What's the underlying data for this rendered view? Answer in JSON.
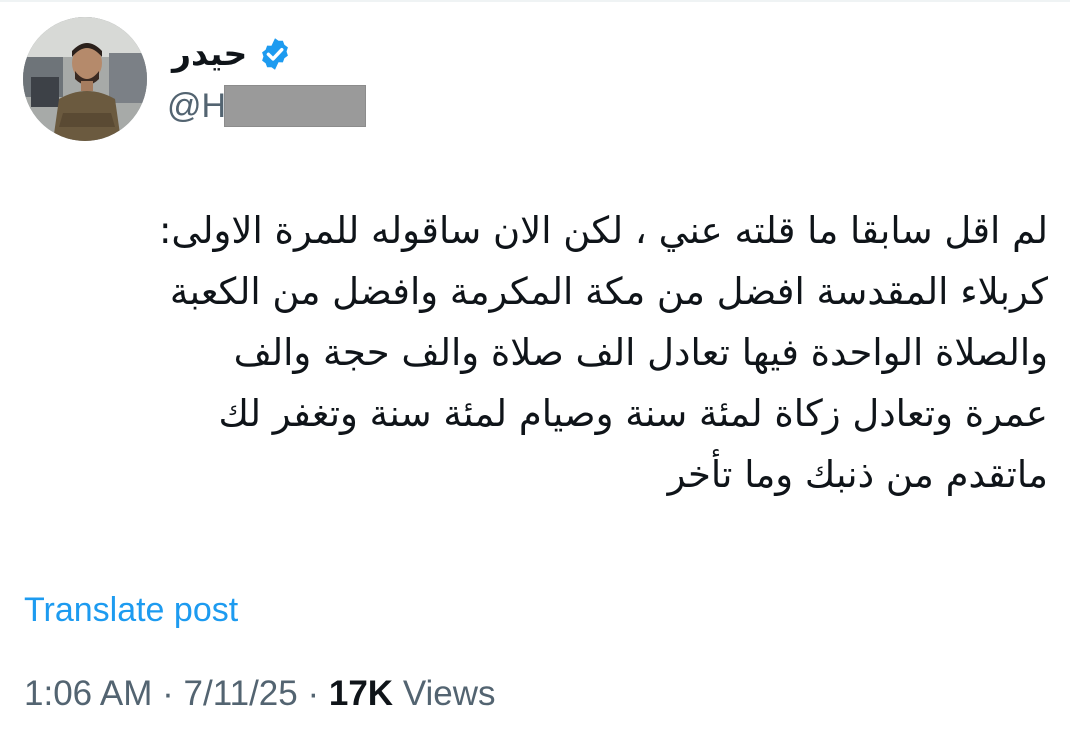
{
  "post": {
    "author": {
      "display_name": "حيدر",
      "verified": true,
      "handle_visible": "@H",
      "avatar_icon": "profile-photo"
    },
    "body_lines": [
      "لم اقل سابقا ما قلته عني ، لكن الان ساقوله للمرة الاولى:",
      "كربلاء المقدسة افضل من مكة المكرمة وافضل من الكعبة",
      "والصلاة الواحدة فيها تعادل الف صلاة والف حجة والف",
      "عمرة وتعادل زكاة لمئة سنة وصيام لمئة سنة وتغفر لك",
      "ماتقدم من ذنبك وما تأخر"
    ],
    "translate_label": "Translate post",
    "time": "1:06 AM",
    "separator": "·",
    "date": "7/11/25",
    "views_count": "17K",
    "views_label": "Views"
  },
  "colors": {
    "link": "#1d9bf0",
    "secondary_text": "#536471",
    "primary_text": "#0f1419",
    "verified_badge": "#1d9bf0",
    "redaction": "#9a9a9a"
  }
}
